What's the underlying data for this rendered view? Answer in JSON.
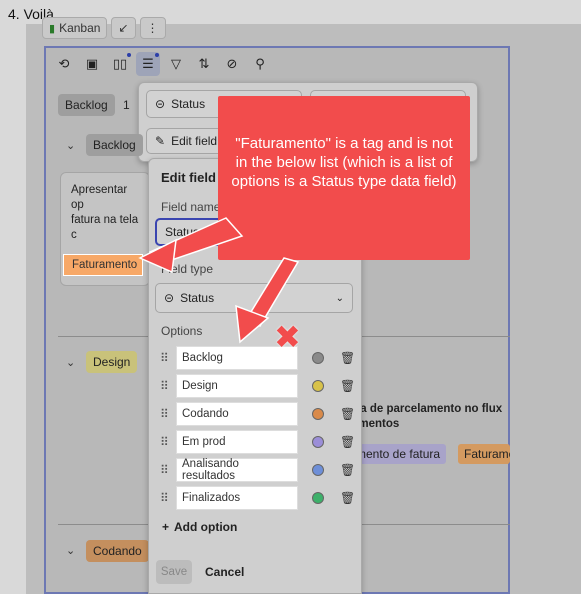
{
  "heading": "4. Voilà",
  "topbar": {
    "kanban_label": "Kanban"
  },
  "backlog_row": {
    "pill": "Backlog",
    "count": "1"
  },
  "status_filter": {
    "label": "Status"
  },
  "edit_field_button": "Edit field",
  "groups": {
    "backlog": "Backlog",
    "design": "Design",
    "codando": "Codando"
  },
  "card": {
    "text_line1": "Apresentar op",
    "text_line2": "fatura na tela c",
    "tag": "Faturamento"
  },
  "right_card": {
    "title_line1": "rta de parcelamento no flux",
    "title_line2": "amentos",
    "tag1": "mento de fatura",
    "tag2": "Faturame"
  },
  "edit_panel": {
    "title": "Edit field",
    "field_name_label": "Field name",
    "field_name_value": "Status",
    "field_type_label": "Field type",
    "field_type_value": "Status",
    "options_label": "Options",
    "options": [
      {
        "label": "Backlog",
        "color": "#8a8a8a"
      },
      {
        "label": "Design",
        "color": "#d8c24a"
      },
      {
        "label": "Codando",
        "color": "#d98a4a"
      },
      {
        "label": "Em prod",
        "color": "#9b8ed8"
      },
      {
        "label": "Analisando resultados",
        "color": "#6e8fd8"
      },
      {
        "label": "Finalizados",
        "color": "#3db06a"
      }
    ],
    "add_option": "Add option",
    "save": "Save",
    "cancel": "Cancel"
  },
  "callout": {
    "text": "\"Faturamento\" is a tag and is not in the below list (which is a list of options is a Status type data field)",
    "color": "#f24c4c"
  },
  "cross_mark": "✖"
}
